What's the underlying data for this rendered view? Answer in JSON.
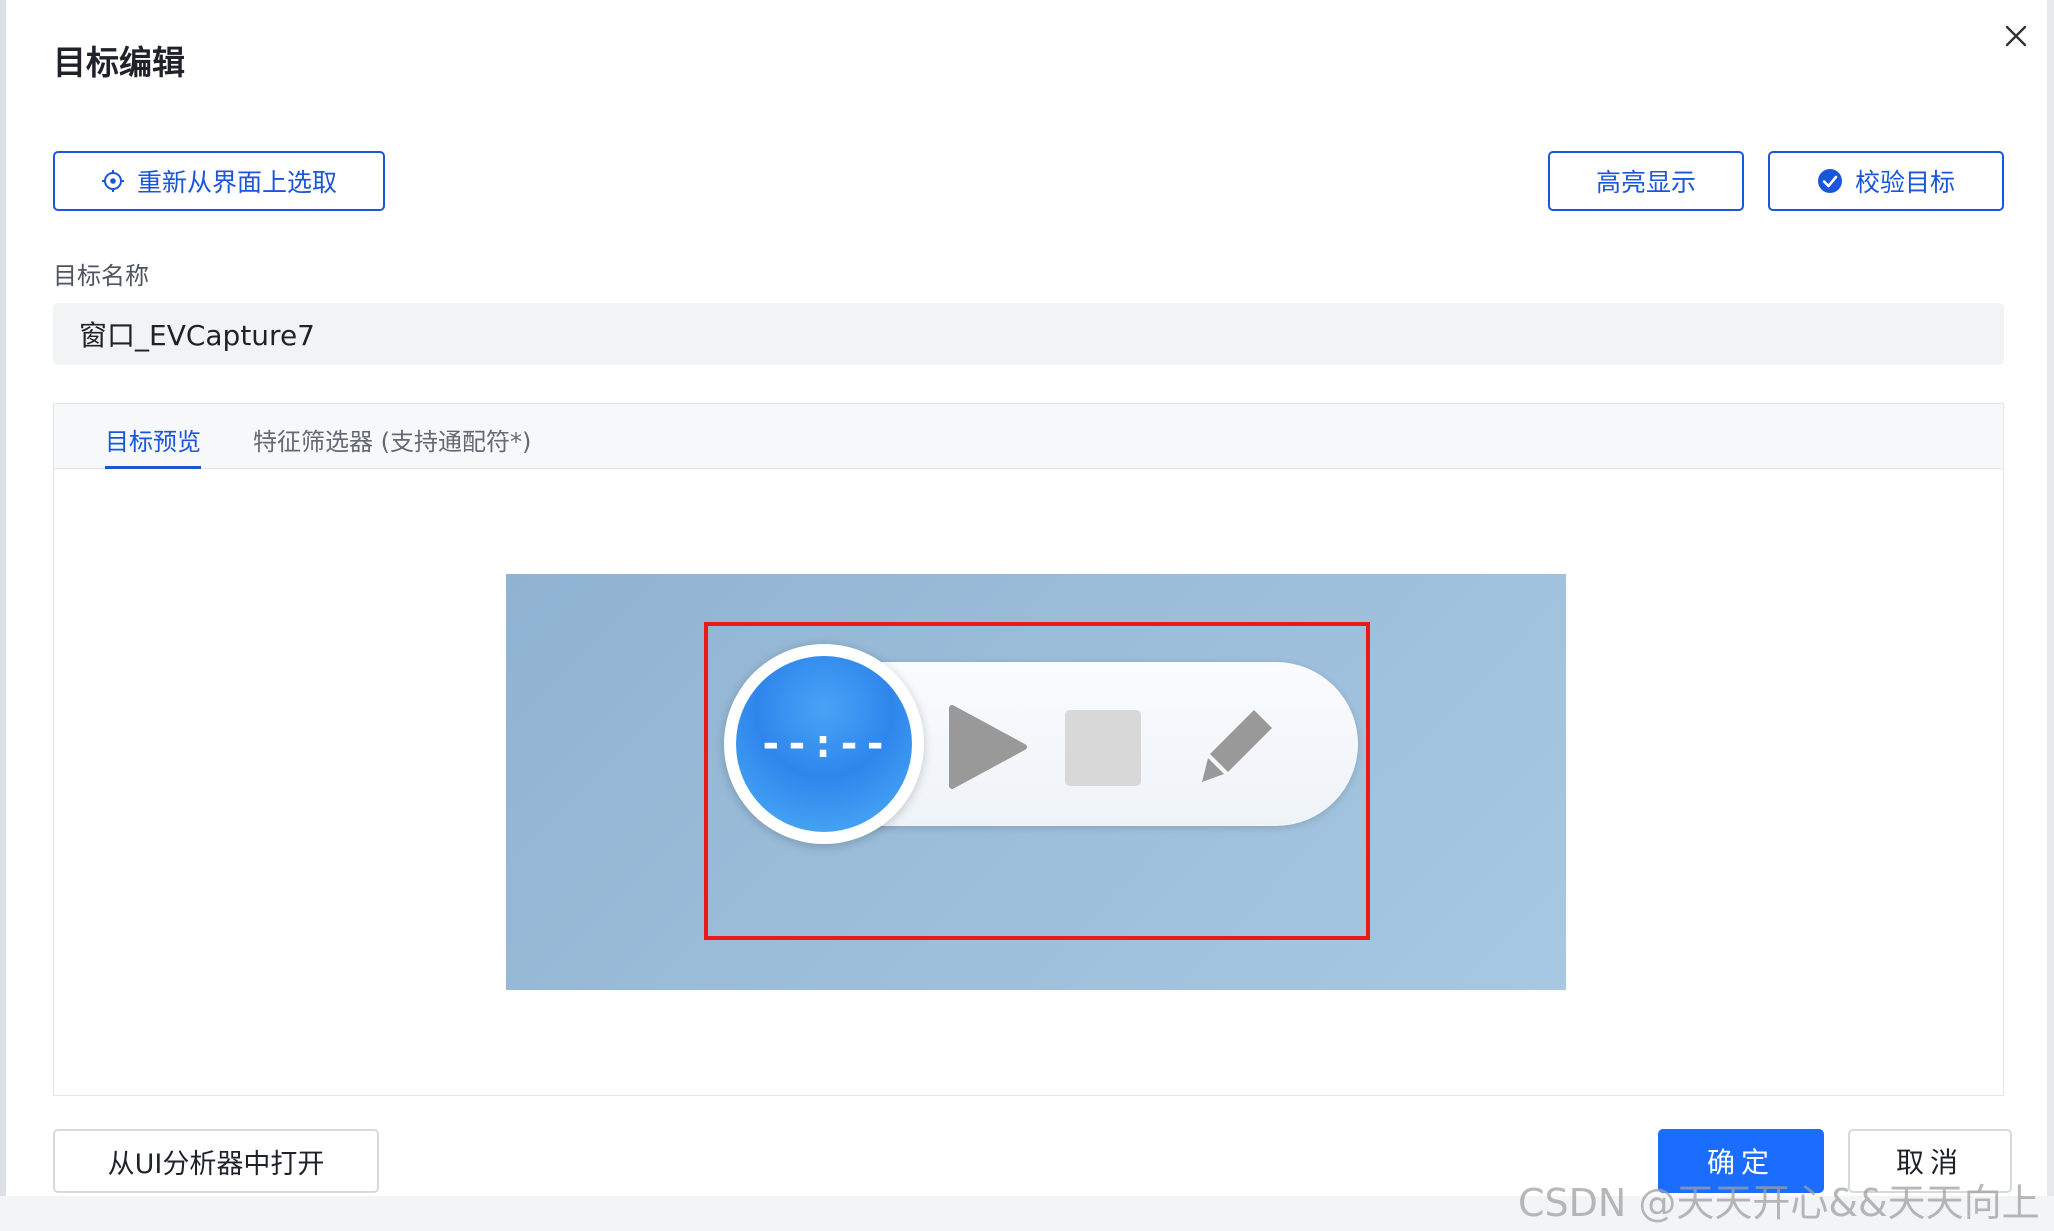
{
  "dialog": {
    "title": "目标编辑",
    "close_icon": "close-icon"
  },
  "toolbar": {
    "reselect_label": "重新从界面上选取",
    "highlight_label": "高亮显示",
    "verify_label": "校验目标"
  },
  "name_field": {
    "label": "目标名称",
    "value": "窗口_EVCapture7"
  },
  "tabs": [
    {
      "label": "目标预览",
      "active": true
    },
    {
      "label": "特征筛选器 (支持通配符*)",
      "active": false
    }
  ],
  "preview": {
    "timer_text": "--:--",
    "icons": [
      "play-icon",
      "stop-icon",
      "pen-icon"
    ],
    "frame_color": "#e81a1a"
  },
  "footer": {
    "analyzer_label": "从UI分析器中打开",
    "ok_label": "确定",
    "cancel_label": "取消"
  },
  "watermark": "CSDN @天天开心&&天天向上",
  "colors": {
    "accent": "#1a56db",
    "primary_button": "#1a6dff"
  }
}
